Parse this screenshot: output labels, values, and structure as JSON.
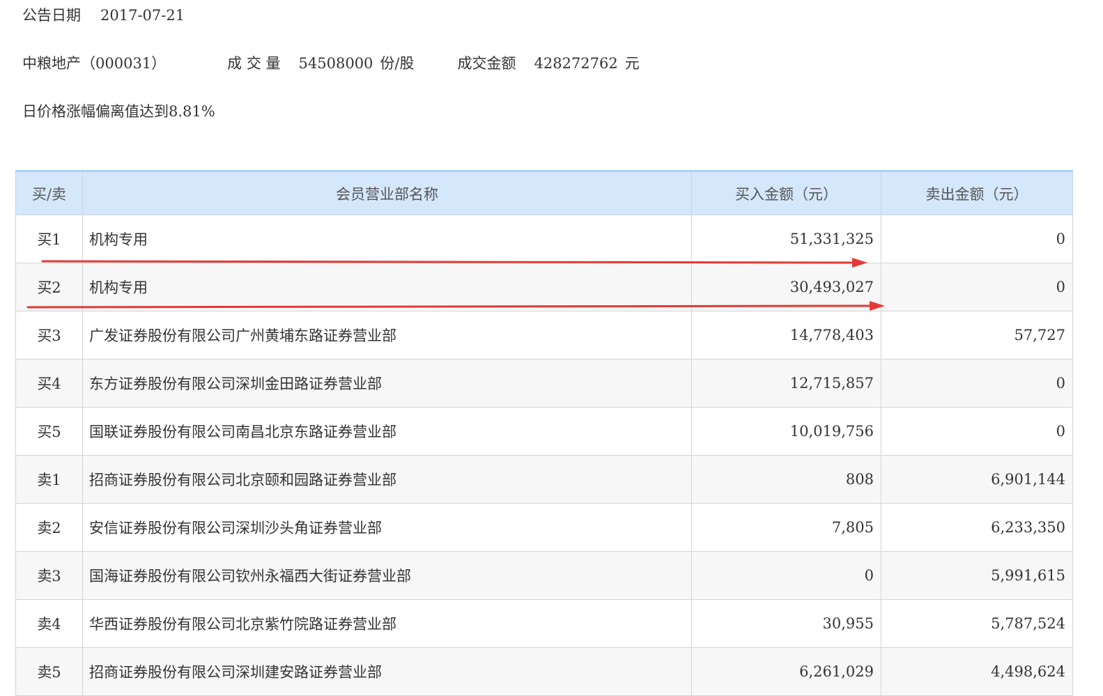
{
  "announcement": {
    "date_label": "公告日期",
    "date_value": "2017-07-21"
  },
  "stock": {
    "name_code": "中粮地产（000031）",
    "volume_label": "成 交 量",
    "volume_value": "54508000",
    "volume_unit": "份/股",
    "amount_label": "成交金额",
    "amount_value": "428272762",
    "amount_unit": "元"
  },
  "reason": "日价格涨幅偏离值达到8.81%",
  "table": {
    "headers": [
      "买/卖",
      "会员营业部名称",
      "买入金额（元）",
      "卖出金额（元）"
    ],
    "rows": [
      {
        "side": "买1",
        "name": "机构专用",
        "buy": "51,331,325",
        "sell": "0"
      },
      {
        "side": "买2",
        "name": "机构专用",
        "buy": "30,493,027",
        "sell": "0"
      },
      {
        "side": "买3",
        "name": "广发证券股份有限公司广州黄埔东路证券营业部",
        "buy": "14,778,403",
        "sell": "57,727"
      },
      {
        "side": "买4",
        "name": "东方证券股份有限公司深圳金田路证券营业部",
        "buy": "12,715,857",
        "sell": "0"
      },
      {
        "side": "买5",
        "name": "国联证券股份有限公司南昌北京东路证券营业部",
        "buy": "10,019,756",
        "sell": "0"
      },
      {
        "side": "卖1",
        "name": "招商证券股份有限公司北京颐和园路证券营业部",
        "buy": "808",
        "sell": "6,901,144"
      },
      {
        "side": "卖2",
        "name": "安信证券股份有限公司深圳沙头角证券营业部",
        "buy": "7,805",
        "sell": "6,233,350"
      },
      {
        "side": "卖3",
        "name": "国海证券股份有限公司钦州永福西大街证券营业部",
        "buy": "0",
        "sell": "5,991,615"
      },
      {
        "side": "卖4",
        "name": "华西证券股份有限公司北京紫竹院路证券营业部",
        "buy": "30,955",
        "sell": "5,787,524"
      },
      {
        "side": "卖5",
        "name": "招商证券股份有限公司深圳建安路证券营业部",
        "buy": "6,261,029",
        "sell": "4,498,624"
      }
    ]
  },
  "colors": {
    "header_bg": "#d5e7fb",
    "header_top_border": "#a8d3ee",
    "annotation_arrow": "#e53935"
  }
}
